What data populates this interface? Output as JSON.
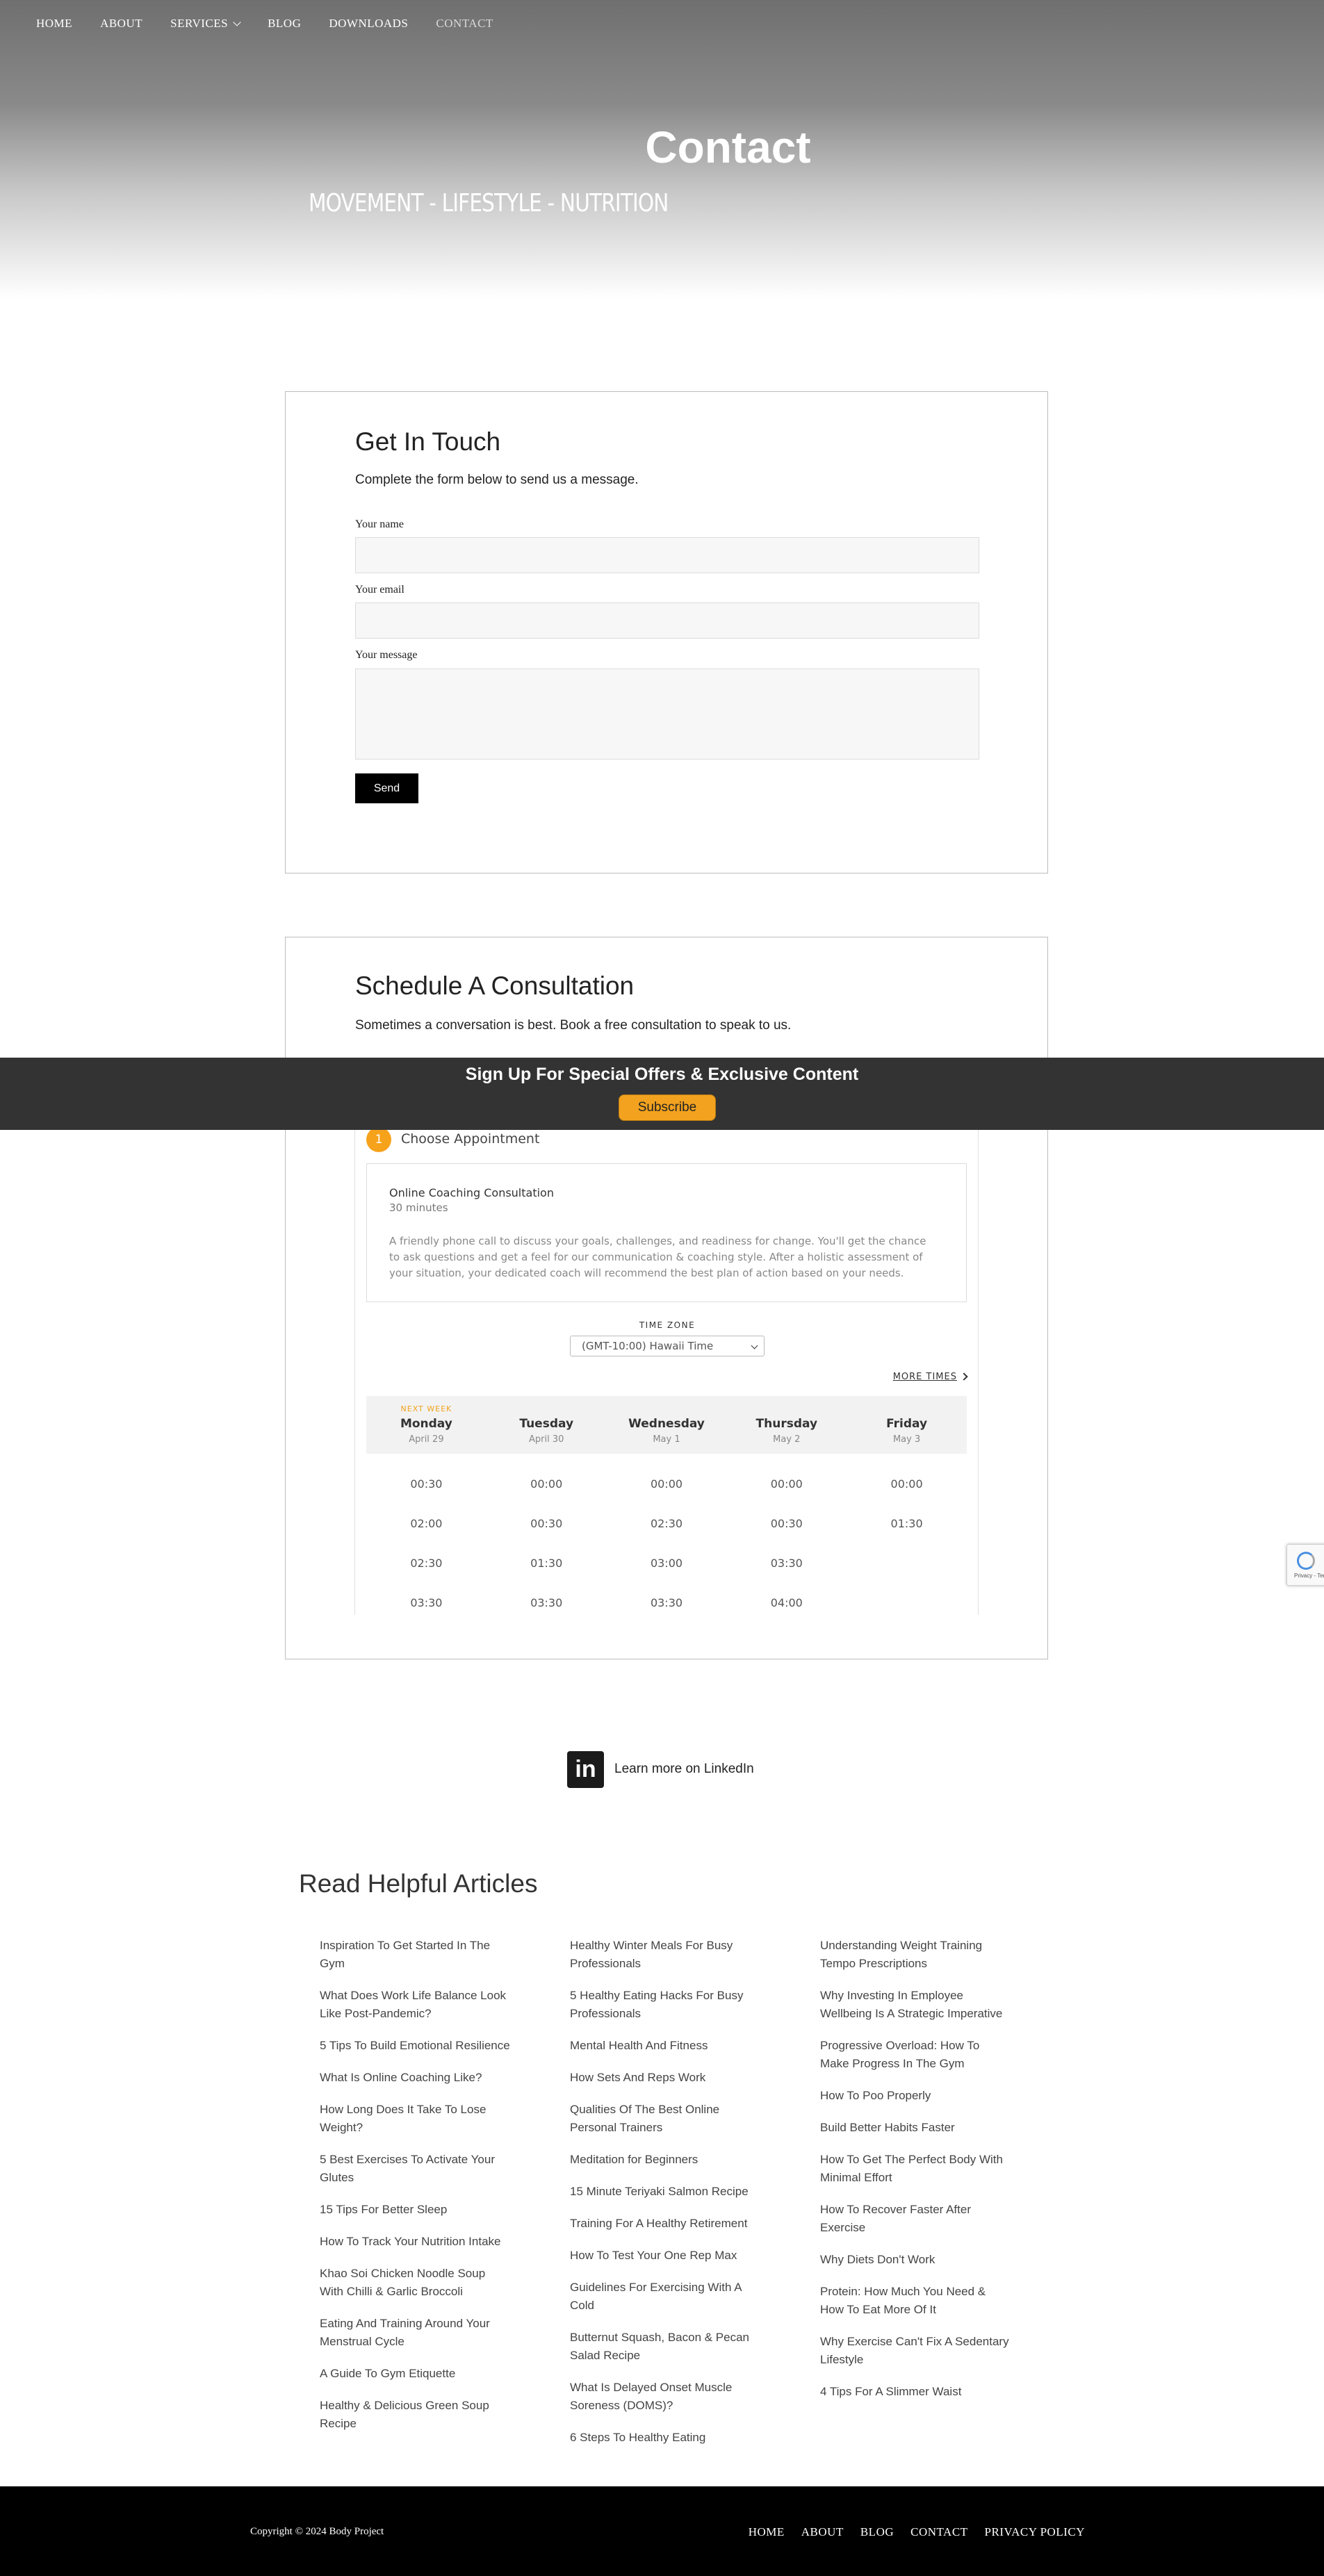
{
  "nav": {
    "items": [
      "HOME",
      "ABOUT",
      "SERVICES",
      "BLOG",
      "DOWNLOADS",
      "CONTACT"
    ],
    "active": "CONTACT"
  },
  "hero": {
    "title": "Contact",
    "tagline": "MOVEMENT - LIFESTYLE - NUTRITION"
  },
  "contact_form": {
    "heading": "Get In Touch",
    "lead": "Complete the form below to send us a message.",
    "name_label": "Your name",
    "name_value": "",
    "email_label": "Your email",
    "email_value": "",
    "message_label": "Your message",
    "message_value": "",
    "send_label": "Send"
  },
  "consultation": {
    "heading": "Schedule A Consultation",
    "lead": "Sometimes a conversation is best. Book a free consultation to speak to us."
  },
  "banner": {
    "title": "Sign Up For Special Offers & Exclusive Content",
    "button": "Subscribe"
  },
  "booking": {
    "step_number": "1",
    "step_label": "Choose Appointment",
    "service_name": "Online Coaching Consultation",
    "service_duration": "30 minutes",
    "service_description": "A friendly phone call to discuss your goals, challenges, and readiness for change. You'll get the chance to ask questions and get a feel for our communication & coaching style. After a holistic assessment of your situation, your dedicated coach will recommend the best plan of action based on your needs.",
    "timezone_label": "TIME ZONE",
    "timezone_value": "(GMT-10:00) Hawaii Time",
    "more_times": "MORE TIMES",
    "days": [
      {
        "tag": "NEXT WEEK",
        "name": "Monday",
        "date": "April 29",
        "slots": [
          "00:30",
          "02:00",
          "02:30",
          "03:30"
        ]
      },
      {
        "tag": "",
        "name": "Tuesday",
        "date": "April 30",
        "slots": [
          "00:00",
          "00:30",
          "01:30",
          "03:30"
        ]
      },
      {
        "tag": "",
        "name": "Wednesday",
        "date": "May 1",
        "slots": [
          "00:00",
          "02:30",
          "03:00",
          "03:30"
        ]
      },
      {
        "tag": "",
        "name": "Thursday",
        "date": "May 2",
        "slots": [
          "00:00",
          "00:30",
          "03:30",
          "04:00"
        ]
      },
      {
        "tag": "",
        "name": "Friday",
        "date": "May 3",
        "slots": [
          "00:00",
          "01:30"
        ]
      }
    ]
  },
  "linkedin": {
    "icon": "linkedin-icon",
    "text": "Learn more on LinkedIn"
  },
  "articles": {
    "heading": "Read Helpful Articles",
    "columns": [
      [
        "Inspiration To Get Started In The Gym",
        "What Does Work Life Balance Look Like Post-Pandemic?",
        "5 Tips To Build Emotional Resilience",
        "What Is Online Coaching Like?",
        "How Long Does It Take To Lose Weight?",
        "5 Best Exercises To Activate Your Glutes",
        "15 Tips For Better Sleep",
        "How To Track Your Nutrition Intake",
        "Khao Soi Chicken Noodle Soup With Chilli & Garlic Broccoli",
        "Eating And Training Around Your Menstrual Cycle",
        "A Guide To Gym Etiquette",
        "Healthy & Delicious Green Soup Recipe"
      ],
      [
        "Healthy Winter Meals For Busy Professionals",
        "5 Healthy Eating Hacks For Busy Professionals",
        "Mental Health And Fitness",
        "How Sets And Reps Work",
        "Qualities Of The Best Online Personal Trainers",
        "Meditation for Beginners",
        "15 Minute Teriyaki Salmon Recipe",
        "Training For A Healthy Retirement",
        "How To Test Your One Rep Max",
        "Guidelines For Exercising With A Cold",
        "Butternut Squash, Bacon & Pecan Salad Recipe",
        "What Is Delayed Onset Muscle Soreness (DOMS)?",
        "6 Steps To Healthy Eating"
      ],
      [
        "Understanding Weight Training Tempo Prescriptions",
        "Why Investing In Employee Wellbeing Is A Strategic Imperative",
        "Progressive Overload: How To Make Progress In The Gym",
        "How To Poo Properly",
        "Build Better Habits Faster",
        "How To Get The Perfect Body With Minimal Effort",
        "How To Recover Faster After Exercise",
        "Why Diets Don't Work",
        "Protein: How Much You Need & How To Eat More Of It",
        "Why Exercise Can't Fix A Sedentary Lifestyle",
        "4 Tips For A Slimmer Waist"
      ]
    ]
  },
  "footer": {
    "copyright": "Copyright © 2024 Body Project",
    "links": [
      "HOME",
      "ABOUT",
      "BLOG",
      "CONTACT",
      "PRIVACY POLICY"
    ]
  },
  "recaptcha": {
    "text": "Privacy - Terms"
  }
}
